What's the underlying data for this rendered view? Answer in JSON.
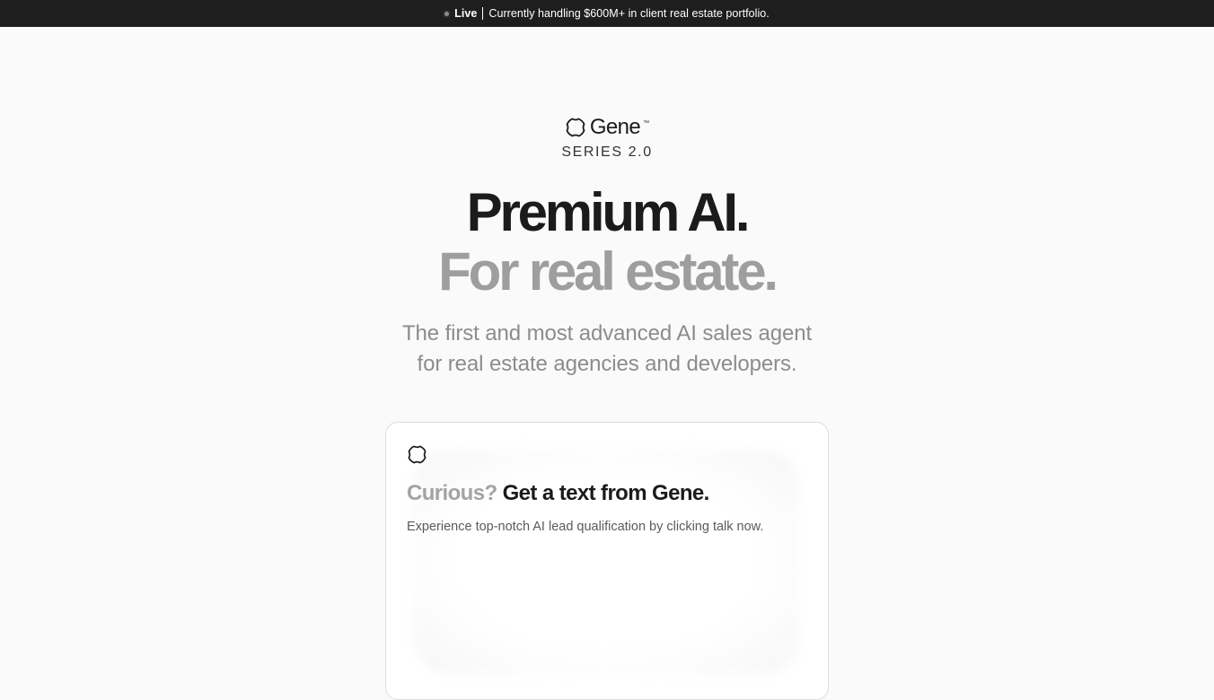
{
  "announcement": {
    "live_label": "Live",
    "message": "Currently handling $600M+ in client real estate portfolio."
  },
  "brand": {
    "name": "Gene",
    "trademark": "™",
    "icon": "gene-logo-icon",
    "series": "SERIES 2.0"
  },
  "hero": {
    "headline_primary": "Premium AI.",
    "headline_secondary": "For real estate.",
    "subtitle_line1": "The first and most advanced AI sales agent",
    "subtitle_line2": "for real estate agencies and developers."
  },
  "card": {
    "icon": "gene-logo-icon",
    "title_muted": "Curious?",
    "title_strong": "Get a text from Gene.",
    "description": "Experience top-notch AI lead qualification by clicking talk now."
  },
  "colors": {
    "topbar_bg": "#1e1e1e",
    "page_bg": "#fafafa",
    "text_primary": "#1b1b1b",
    "text_muted": "#9e9e9e"
  }
}
